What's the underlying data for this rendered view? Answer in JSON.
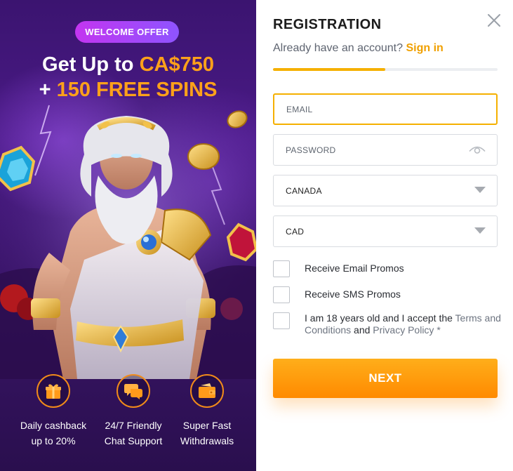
{
  "promo": {
    "badge": "WELCOME OFFER",
    "headline_line1_prefix": "Get Up to ",
    "headline_line1_amount": "CA$750",
    "headline_line2_plus": "+ ",
    "headline_line2_spins": "150 FREE SPINS",
    "features": [
      {
        "icon": "gift-icon",
        "label": "Daily cashback\nup to 20%"
      },
      {
        "icon": "chat-bubbles-icon",
        "label": "24/7 Friendly\nChat Support"
      },
      {
        "icon": "wallet-icon",
        "label": "Super Fast\nWithdrawals"
      }
    ],
    "colors": {
      "accent": "#ffa11a",
      "background": "#3b1470",
      "badge_from": "#c335f0",
      "badge_to": "#8e54ff"
    }
  },
  "form": {
    "title": "REGISTRATION",
    "already_text": "Already have an account?",
    "signin_label": "Sign in",
    "progress_fraction": 0.5,
    "email": {
      "placeholder": "EMAIL",
      "value": ""
    },
    "password": {
      "placeholder": "PASSWORD",
      "value": "",
      "icon": "eye-icon"
    },
    "country": {
      "value": "CANADA",
      "icon": "chevron-down-icon"
    },
    "currency": {
      "value": "CAD",
      "icon": "chevron-down-icon"
    },
    "checkboxes": {
      "email_promos": "Receive Email Promos",
      "sms_promos": "Receive SMS Promos",
      "age_prefix": "I am 18 years old and I accept the ",
      "terms_link": "Terms and Conditions",
      "and_text": " and ",
      "privacy_link": "Privacy Policy",
      "required_mark": " *"
    },
    "next_label": "NEXT",
    "colors": {
      "accent": "#f5b000",
      "button": "#ff9800"
    }
  }
}
